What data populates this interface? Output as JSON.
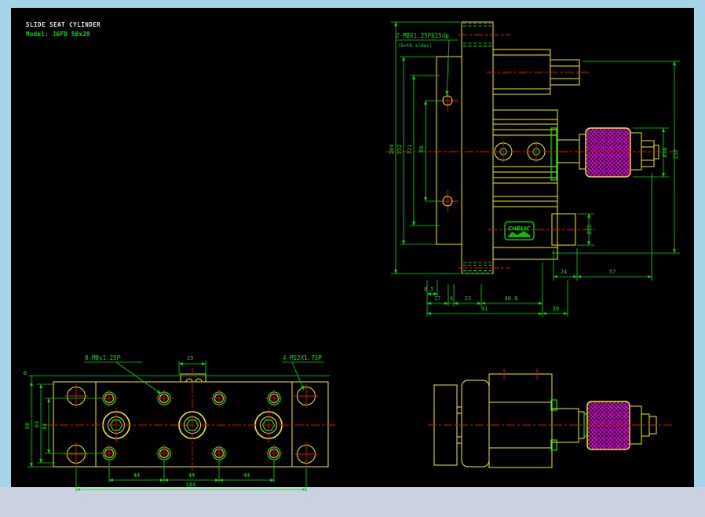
{
  "title_block": {
    "line1": "SLIDE SEAT CYLINDER",
    "line2": "Model: JGFD 50x20"
  },
  "side_view": {
    "thread_label": "2-M8X1.25PX15dp",
    "thread_note": "(Both sides)",
    "logo": "CHELIC",
    "dims": {
      "v204": "204",
      "v152": "152",
      "v121": "121",
      "v80": "80",
      "b8_5": "8.5",
      "b17": "17",
      "b4": "4",
      "b22": "22",
      "b48_6": "48.6",
      "b91": "91",
      "b20": "20",
      "r24": "24",
      "r57": "57",
      "dia38": "Ø38",
      "r157": "157",
      "dia25": "Ø25"
    }
  },
  "plan_view": {
    "labels": {
      "m8": "8-M8x1.25P",
      "slot19": "19",
      "m12": "4-M12X1.75P"
    },
    "dims": {
      "d6": "6",
      "d68": "68",
      "d64": "64",
      "d44v": "44",
      "d44a": "44",
      "d44b": "44",
      "d44c": "44",
      "d184": "184"
    }
  },
  "colors": {
    "canvas": "#000000",
    "frame": "#a5d3e8",
    "bottom_strip": "#c9d2de",
    "geometry": "#f0f000",
    "dimension": "#00dc00",
    "centerline": "#e01000",
    "knurl": "#d800d8",
    "title": "#e8e8e8"
  }
}
